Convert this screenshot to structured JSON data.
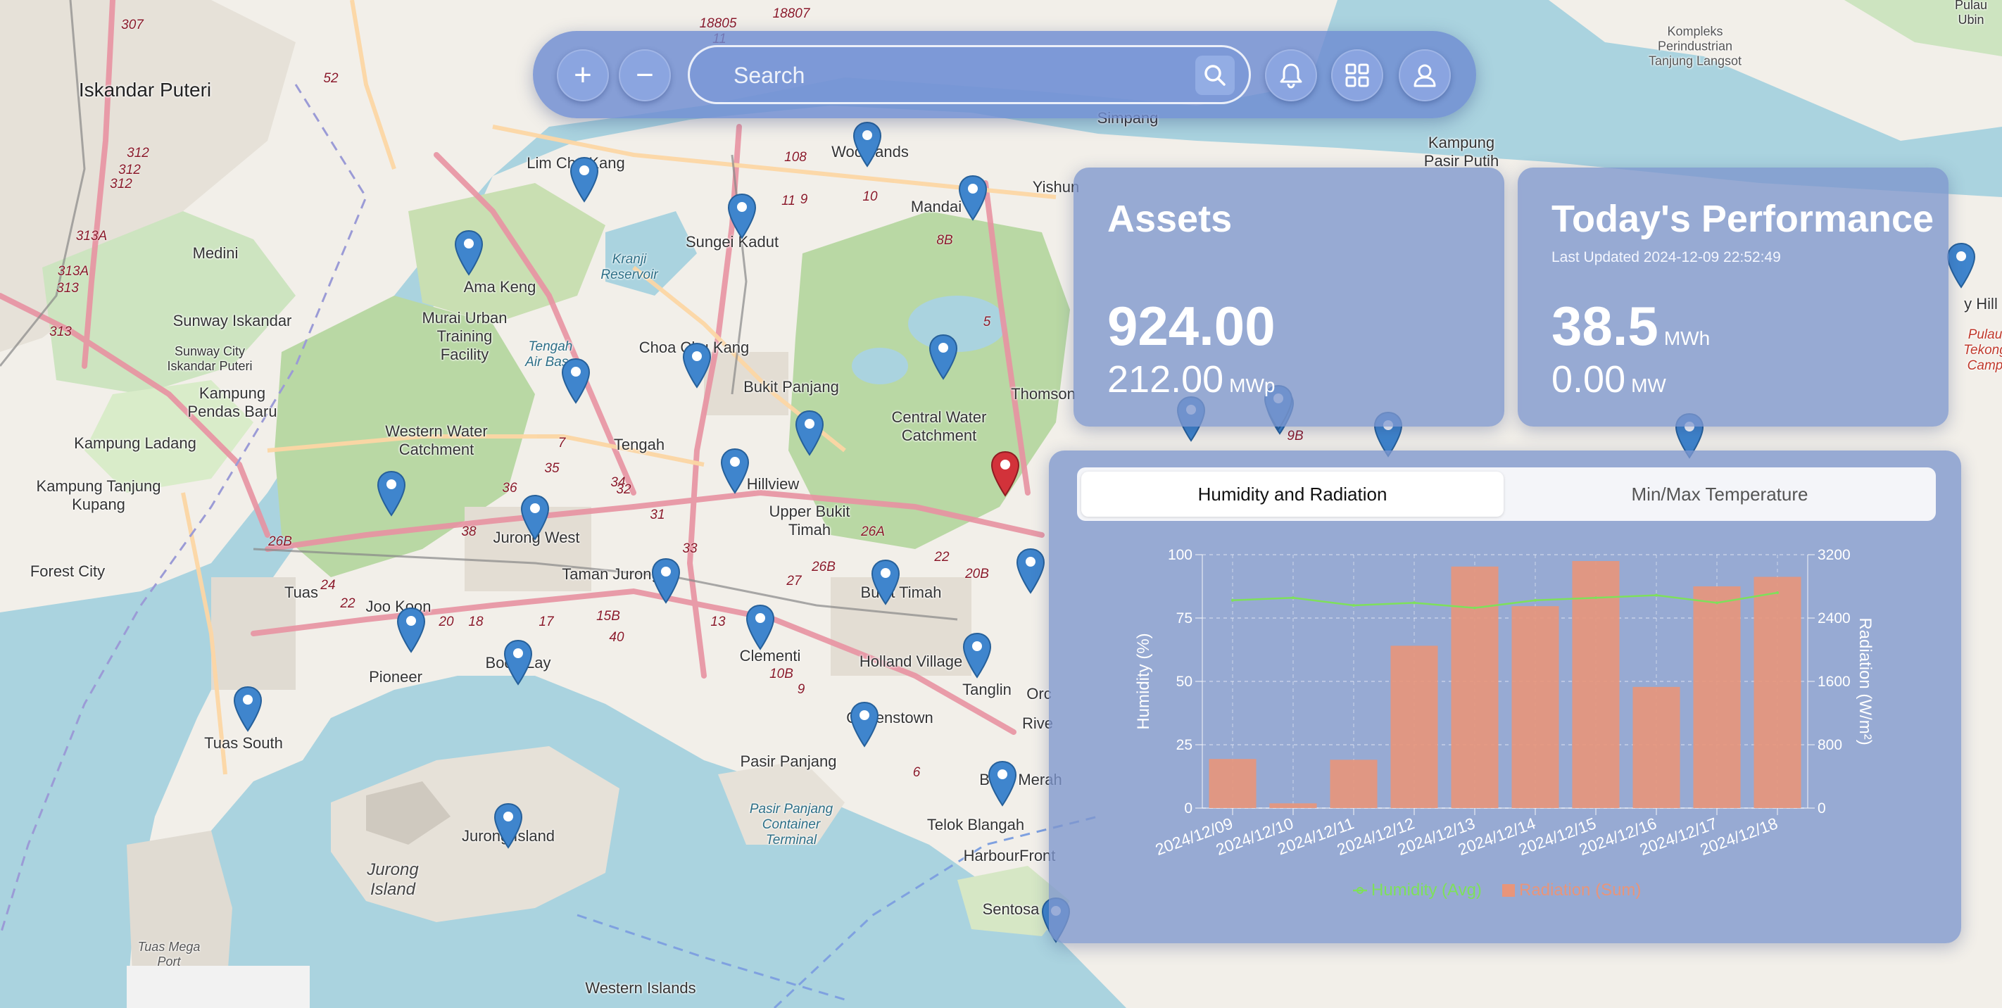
{
  "toolbar": {
    "zoom_in_icon": "+",
    "zoom_out_icon": "−",
    "search_placeholder": "Search",
    "icons": [
      "plus-icon",
      "minus-icon",
      "search-icon",
      "bell-icon",
      "grid-icon",
      "user-icon"
    ]
  },
  "map": {
    "labels": {
      "iskandar_puteri": "Iskandar Puteri",
      "medini": "Medini",
      "sunway": "Sunway Iskandar",
      "sunway_city": "Sunway City Iskandar Puteri",
      "kampung_pendas": "Kampung Pendas Baru",
      "kampung_ladang": "Kampung Ladang",
      "kampung_tanjung": "Kampung Tanjung Kupang",
      "forest_city": "Forest City",
      "lim_chu_kang": "Lim Chu Kang",
      "ama_keng": "Ama Keng",
      "murai": "Murai Urban Training Facility",
      "tengah_air": "Tengah Air Base",
      "kranji": "Kranji Reservoir",
      "sungei_kadut": "Sungei Kadut",
      "woodlands": "Woodlands",
      "mandai": "Mandai",
      "yishun": "Yishun",
      "simpang": "Simpang",
      "kampung_pasir": "Kampung Pasir Putih",
      "kompleks": "Kompleks Perindustrian Tanjung Langsot",
      "pulau_ubin": "Pulau Ubin",
      "choa_chu_kang": "Choa Chu Kang",
      "bukit_panjang": "Bukit Panjang",
      "central_water": "Central Water Catchment",
      "thomson": "Thomson",
      "western_water": "Western Water Catchment",
      "tengah": "Tengah",
      "hillview": "Hillview",
      "upper_bukit_timah": "Upper Bukit Timah",
      "jurong_west": "Jurong West",
      "taman_jurong": "Taman Jurong",
      "bukit_timah": "Bukit Timah",
      "tuas": "Tuas",
      "joo_koon": "Joo Koon",
      "pioneer": "Pioneer",
      "boon_lay": "Boon Lay",
      "clementi": "Clementi",
      "holland_village": "Holland Village",
      "tanglin": "Tanglin",
      "queenstown": "Queenstown",
      "tuas_south": "Tuas South",
      "pasir_panjang": "Pasir Panjang",
      "pasir_panjang_ct": "Pasir Panjang Container Terminal",
      "telok_blangah": "Telok Blangah",
      "bukit_merah": "Bukit Merah",
      "harbourfront": "HarbourFront",
      "sentosa": "Sentosa",
      "jurong_island_area": "Jurong Island",
      "jurong_island": "Jurong Island",
      "tuas_mega_port": "Tuas Mega Port",
      "western_islands": "Western Islands",
      "bukit_hill": "y Hill",
      "pulau_tekong": "Pulau Tekong Camp",
      "orchard": "Orc",
      "river": "Rive"
    },
    "road_numbers": [
      "307",
      "52",
      "312",
      "312",
      "312",
      "313A",
      "313A",
      "313",
      "313",
      "108",
      "11",
      "9",
      "10",
      "8B",
      "5",
      "9B",
      "34",
      "35",
      "36",
      "7",
      "32",
      "31",
      "33",
      "38",
      "26B",
      "24",
      "22",
      "20",
      "18",
      "17",
      "15B",
      "40",
      "13",
      "27",
      "26B",
      "26A",
      "22",
      "20B",
      "10B",
      "9",
      "6",
      "18805",
      "18807",
      "11"
    ]
  },
  "assets": {
    "title": "Assets",
    "value": "924.00",
    "capacity": "212.00",
    "capacity_unit": "MWp"
  },
  "performance": {
    "title": "Today's Performance",
    "last_updated": "Last Updated 2024-12-09 22:52:49",
    "energy": "38.5",
    "energy_unit": "MWh",
    "power": "0.00",
    "power_unit": "MW"
  },
  "tabs": {
    "humidity_radiation": "Humidity and Radiation",
    "min_max_temp": "Min/Max Temperature"
  },
  "colors": {
    "humidity_line": "#7ee05b",
    "radiation_bar": "#e8957a",
    "panel": "#7d96cd"
  },
  "chart_data": {
    "type": "bar",
    "categories": [
      "2024/12/09",
      "2024/12/10",
      "2024/12/11",
      "2024/12/12",
      "2024/12/13",
      "2024/12/14",
      "2024/12/15",
      "2024/12/16",
      "2024/12/17",
      "2024/12/18"
    ],
    "series": [
      {
        "name": "Humidity (Avg)",
        "type": "line",
        "axis": "left",
        "values": [
          82,
          83,
          80,
          81,
          79,
          82,
          83,
          84,
          81,
          85
        ]
      },
      {
        "name": "Radiation (Sum)",
        "type": "bar",
        "axis": "right",
        "values": [
          620,
          60,
          610,
          2050,
          3050,
          2550,
          3120,
          1530,
          2800,
          2920
        ]
      }
    ],
    "ylabel": "Humidity (%)",
    "ylabel_right": "Radiation (W/m²)",
    "ylim": [
      0,
      100
    ],
    "ylim_right": [
      0,
      3200
    ],
    "yticks": [
      "0",
      "25",
      "50",
      "75",
      "100"
    ],
    "yticks_right": [
      "0",
      "800",
      "1600",
      "2400",
      "3200"
    ],
    "grid": true,
    "legend": "bottom"
  }
}
